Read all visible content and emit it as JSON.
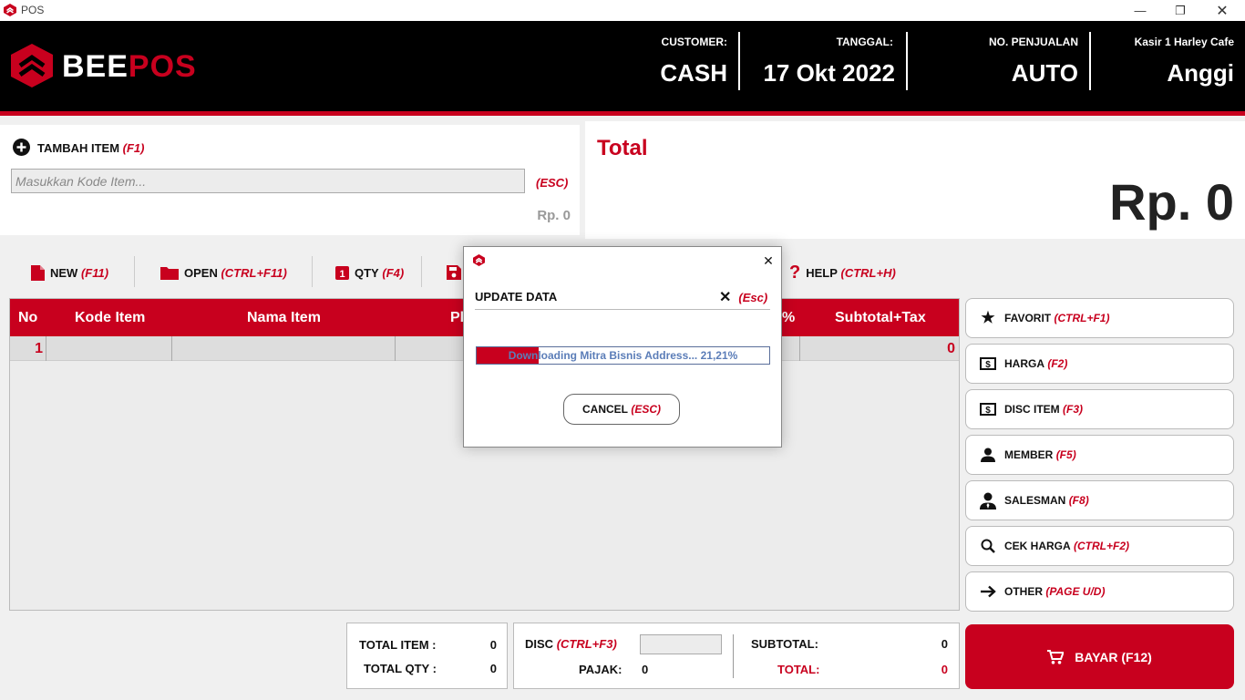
{
  "window": {
    "title": "POS",
    "minimize_icon": "minimize-icon",
    "restore_icon": "restore-icon",
    "close_icon": "close-icon"
  },
  "brand": {
    "name_part1": "BEE",
    "name_part2": "POS",
    "accent": "#c8001e"
  },
  "header": {
    "customer_label": "CUSTOMER:",
    "customer_value": "CASH",
    "date_label": "TANGGAL:",
    "date_value": "17 Okt 2022",
    "sale_no_label": "NO. PENJUALAN",
    "sale_no_value": "AUTO",
    "cashier_label": "Kasir 1 Harley Cafe",
    "cashier_value": "Anggi"
  },
  "add_item": {
    "label": "TAMBAH ITEM",
    "shortcut": "(F1)",
    "placeholder": "Masukkan Kode Item...",
    "esc": "(ESC)",
    "price": "Rp. 0"
  },
  "total_panel": {
    "label": "Total",
    "value": "Rp. 0"
  },
  "toolbar": [
    {
      "label": "NEW",
      "shortcut": "(F11)",
      "icon": "file-icon"
    },
    {
      "label": "OPEN",
      "shortcut": "(CTRL+F11)",
      "icon": "folder-icon"
    },
    {
      "label": "QTY",
      "shortcut": "(F4)",
      "icon": "number-one-icon"
    },
    {
      "label": "HELP",
      "shortcut": "(CTRL+H)",
      "icon": "question-icon"
    }
  ],
  "table": {
    "columns": [
      "No",
      "Kode Item",
      "Nama Item",
      "Pl",
      "%",
      "Subtotal+Tax"
    ],
    "rows": [
      {
        "no": "1",
        "subtotal": "0"
      }
    ]
  },
  "side_buttons": [
    {
      "label": "FAVORIT",
      "shortcut": "(CTRL+F1)",
      "icon": "star-icon"
    },
    {
      "label": "HARGA",
      "shortcut": "(F2)",
      "icon": "dollar-icon"
    },
    {
      "label": "DISC ITEM",
      "shortcut": "(F3)",
      "icon": "dollar-icon"
    },
    {
      "label": "MEMBER",
      "shortcut": "(F5)",
      "icon": "person-icon"
    },
    {
      "label": "SALESMAN",
      "shortcut": "(F8)",
      "icon": "person-tie-icon"
    },
    {
      "label": "CEK HARGA",
      "shortcut": "(CTRL+F2)",
      "icon": "search-icon"
    },
    {
      "label": "OTHER",
      "shortcut": "(PAGE U/D)",
      "icon": "arrow-right-icon"
    }
  ],
  "summary": {
    "total_item_label": "TOTAL ITEM :",
    "total_item_value": "0",
    "total_qty_label": "TOTAL QTY :",
    "total_qty_value": "0",
    "disc_label": "DISC",
    "disc_shortcut": "(CTRL+F3)",
    "pajak_label": "PAJAK:",
    "pajak_value": "0",
    "subtotal_label": "SUBTOTAL:",
    "subtotal_value": "0",
    "total_label": "TOTAL:",
    "total_value": "0"
  },
  "pay_button": {
    "label": "BAYAR (F12)",
    "icon": "cart-icon"
  },
  "modal": {
    "title": "UPDATE DATA",
    "esc": "(Esc)",
    "progress_text": "Downloading Mitra Bisnis Address... 21,21%",
    "progress": 0.2121,
    "cancel_label": "CANCEL",
    "cancel_shortcut": "(ESC)"
  }
}
